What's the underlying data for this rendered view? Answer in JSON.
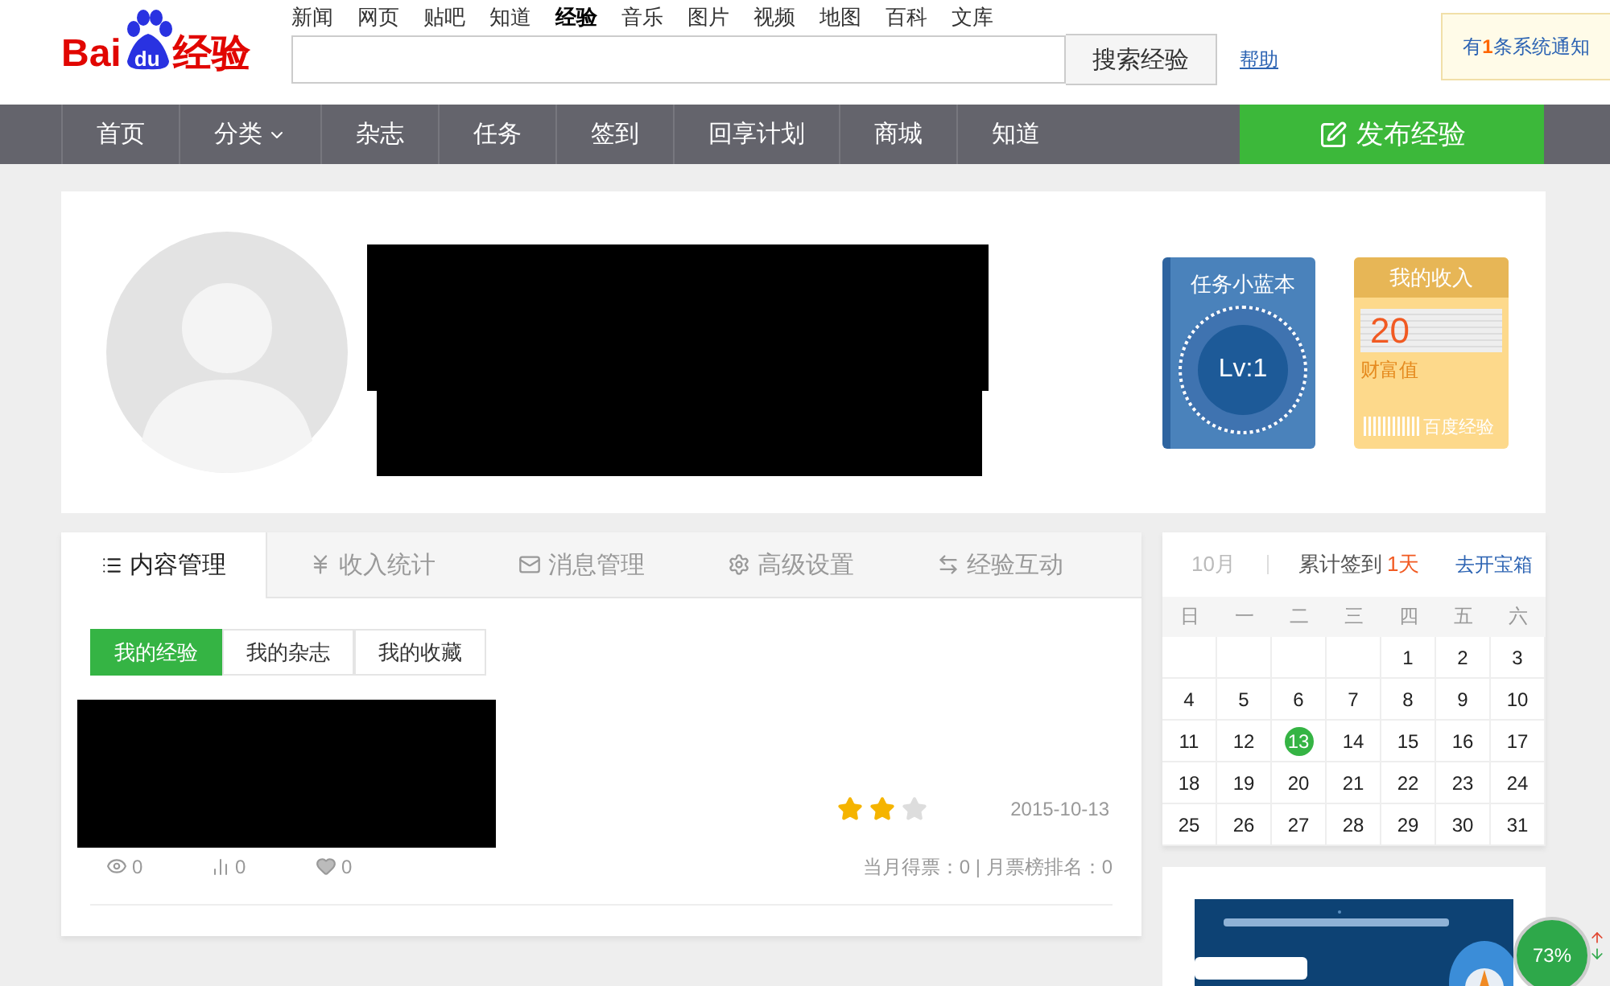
{
  "logo": {
    "left": "Bai",
    "paw": "du",
    "right": "经验"
  },
  "top_links": [
    {
      "label": "新闻",
      "selected": false
    },
    {
      "label": "网页",
      "selected": false
    },
    {
      "label": "贴吧",
      "selected": false
    },
    {
      "label": "知道",
      "selected": false
    },
    {
      "label": "经验",
      "selected": true
    },
    {
      "label": "音乐",
      "selected": false
    },
    {
      "label": "图片",
      "selected": false
    },
    {
      "label": "视频",
      "selected": false
    },
    {
      "label": "地图",
      "selected": false
    },
    {
      "label": "百科",
      "selected": false
    },
    {
      "label": "文库",
      "selected": false
    }
  ],
  "search": {
    "button": "搜索经验"
  },
  "help_link": "帮助",
  "notification": "有**1**条系统通知",
  "nav": [
    {
      "label": "首页",
      "dropdown": false
    },
    {
      "label": "分类",
      "dropdown": true
    },
    {
      "label": "杂志",
      "dropdown": false
    },
    {
      "label": "任务",
      "dropdown": false
    },
    {
      "label": "签到",
      "dropdown": false
    },
    {
      "label": "回享计划",
      "dropdown": false
    },
    {
      "label": "商城",
      "dropdown": false
    },
    {
      "label": "知道",
      "dropdown": false
    }
  ],
  "publish_button": "发布经验",
  "task_book": {
    "title": "任务小蓝本",
    "level": "Lv:1"
  },
  "income_card": {
    "title": "我的收入",
    "value": "20",
    "label": "财富值",
    "footer": "百度经验"
  },
  "tabs": [
    {
      "label": "内容管理",
      "selected": true
    },
    {
      "label": "收入统计",
      "selected": false
    },
    {
      "label": "消息管理",
      "selected": false
    },
    {
      "label": "高级设置",
      "selected": false
    },
    {
      "label": "经验互动",
      "selected": false
    }
  ],
  "subtabs": [
    {
      "label": "我的经验",
      "selected": true
    },
    {
      "label": "我的杂志",
      "selected": false
    },
    {
      "label": "我的收藏",
      "selected": false
    }
  ],
  "article": {
    "stars": 2,
    "date": "2015-10-13",
    "views": "0",
    "votes": "0",
    "likes": "0",
    "ranking": "当月得票：0 | 月票榜排名：0"
  },
  "calendar": {
    "month": "10月",
    "signin_label": "累计签到",
    "signin_days": "1天",
    "treasure_link": "去开宝箱",
    "weekdays": [
      "日",
      "一",
      "二",
      "三",
      "四",
      "五",
      "六"
    ],
    "weeks": [
      [
        {
          "day": "1",
          "today": false
        },
        {
          "day": "2",
          "today": false
        },
        {
          "day": "3",
          "today": false
        }
      ],
      [
        {
          "day": "4",
          "today": false
        },
        {
          "day": "5",
          "today": false
        },
        {
          "day": "6",
          "today": false
        },
        {
          "day": "7",
          "today": false
        },
        {
          "day": "8",
          "today": false
        },
        {
          "day": "9",
          "today": false
        },
        {
          "day": "10",
          "today": false
        }
      ],
      [
        {
          "day": "11",
          "today": false
        },
        {
          "day": "12",
          "today": false
        },
        {
          "day": "13",
          "today": true
        },
        {
          "day": "14",
          "today": false
        },
        {
          "day": "15",
          "today": false
        },
        {
          "day": "16",
          "today": false
        },
        {
          "day": "17",
          "today": false
        }
      ],
      [
        {
          "day": "18",
          "today": false
        },
        {
          "day": "19",
          "today": false
        },
        {
          "day": "20",
          "today": false
        },
        {
          "day": "21",
          "today": false
        },
        {
          "day": "22",
          "today": false
        },
        {
          "day": "23",
          "today": false
        },
        {
          "day": "24",
          "today": false
        }
      ],
      [
        {
          "day": "25",
          "today": false
        },
        {
          "day": "26",
          "today": false
        },
        {
          "day": "27",
          "today": false
        },
        {
          "day": "28",
          "today": false
        },
        {
          "day": "29",
          "today": false
        },
        {
          "day": "30",
          "today": false
        },
        {
          "day": "31",
          "today": false
        }
      ]
    ]
  },
  "speed_widget": {
    "percent": "73%"
  }
}
